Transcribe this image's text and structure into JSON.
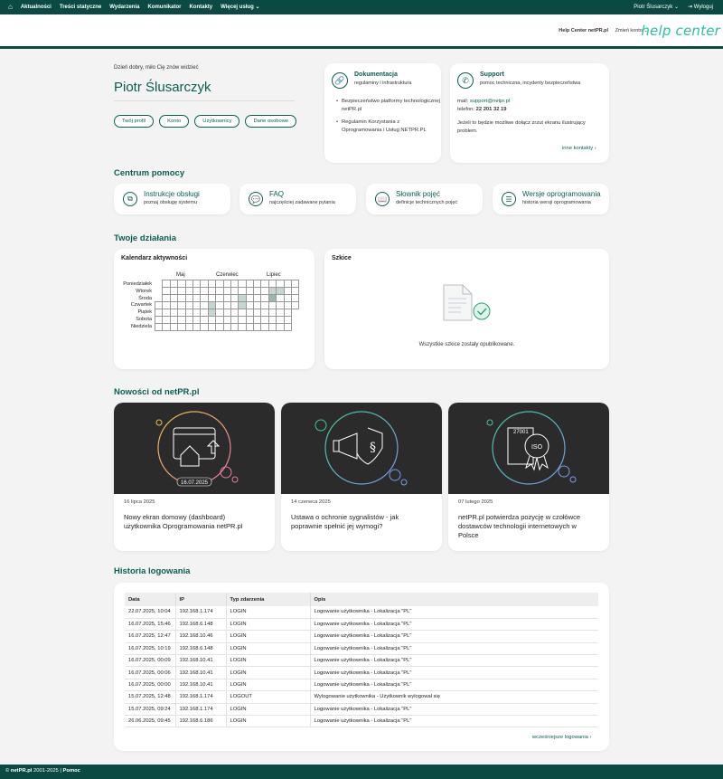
{
  "topnav": {
    "items": [
      "Aktualności",
      "Treści statyczne",
      "Wydarzenia",
      "Komunikator",
      "Kontakty",
      "Więcej usług"
    ],
    "user": "Piotr Ślusarczyk",
    "logout": "Wyloguj"
  },
  "header": {
    "help_center_link": "Help Center netPR.pl",
    "switch_account": "Zmień konto",
    "logo_text": "help center"
  },
  "profile": {
    "greeting": "Dzień dobry, miło Cię znów widzieć",
    "name": "Piotr Ślusarczyk",
    "buttons": [
      "Twój profil",
      "Konto",
      "Użytkownicy",
      "Dane osobowe"
    ]
  },
  "documentation": {
    "title": "Dokumentacja",
    "subtitle": "regulaminy i infrastruktura",
    "items": [
      "Bezpieczeństwo platformy technologicznej netPR.pl",
      "Regulamin Korzystania z Oprogramowania i Usług NETPR.PL"
    ]
  },
  "support": {
    "title": "Support",
    "subtitle": "pomoc techniczna, incydenty bezpieczeństwa",
    "mail_label": "mail:",
    "mail": "support@netpr.pl",
    "phone_label": "telefon:",
    "phone": "22 201 32 19",
    "note": "Jeżeli to będzie możliwe dołącz zrzut ekranu ilustrujący problem.",
    "more": "inne kontakty"
  },
  "help_center": {
    "title": "Centrum pomocy",
    "cards": [
      {
        "title": "Instrukcje obsługi",
        "subtitle": "poznaj obsługę systemu",
        "icon": "copy-icon"
      },
      {
        "title": "FAQ",
        "subtitle": "najczęściej zadawane pytania",
        "icon": "chat-icon"
      },
      {
        "title": "Słownik pojęć",
        "subtitle": "definicje technicznych pojęć",
        "icon": "book-icon"
      },
      {
        "title": "Wersje oprogramowania",
        "subtitle": "historia wersji oprogramowania",
        "icon": "layers-icon"
      }
    ]
  },
  "activity": {
    "title": "Twoje działania",
    "calendar_title": "Kalendarz aktywności",
    "months": [
      "Maj",
      "Czerwiec",
      "Lipiec"
    ],
    "days": [
      "Poniedziałek",
      "Wtorek",
      "Środa",
      "Czwartek",
      "Piątek",
      "Sobota",
      "Niedziela"
    ],
    "drafts_title": "Szkice",
    "drafts_empty": "Wszystkie szkice zostały opublikowane."
  },
  "news": {
    "title": "Nowości od netPR.pl",
    "items": [
      {
        "date": "16 lipca 2025",
        "title": "Nowy ekran domowy (dashboard) użytkownika Oprogramowania netPR.pl",
        "badge": "16.07.2025"
      },
      {
        "date": "14 czerwca 2025",
        "title": "Ustawa o ochronie sygnalistów - jak poprawnie spełnić jej wymogi?"
      },
      {
        "date": "07 lutego 2025",
        "title": "netPR.pl potwierdza pozycję w czołówce dostawców technologii internetowych w Polsce",
        "badge": "27001",
        "badge2": "ISO"
      }
    ]
  },
  "history": {
    "title": "Historia logowania",
    "columns": [
      "Data",
      "IP",
      "Typ zdarzenia",
      "Opis"
    ],
    "rows": [
      [
        "22.07.2025, 10:04",
        "192.168.1.174",
        "LOGIN",
        "Logowanie użytkownika - Lokalizacja \"PL\""
      ],
      [
        "16.07.2025, 15:46",
        "192.168.6.148",
        "LOGIN",
        "Logowanie użytkownika - Lokalizacja \"PL\""
      ],
      [
        "16.07.2025, 12:47",
        "192.168.10.46",
        "LOGIN",
        "Logowanie użytkownika - Lokalizacja \"PL\""
      ],
      [
        "16.07.2025, 10:19",
        "192.168.6.148",
        "LOGIN",
        "Logowanie użytkownika - Lokalizacja \"PL\""
      ],
      [
        "16.07.2025, 00:09",
        "192.168.10.41",
        "LOGIN",
        "Logowanie użytkownika - Lokalizacja \"PL\""
      ],
      [
        "16.07.2025, 00:06",
        "192.168.10.41",
        "LOGIN",
        "Logowanie użytkownika - Lokalizacja \"PL\""
      ],
      [
        "16.07.2025, 00:00",
        "192.168.10.41",
        "LOGIN",
        "Logowanie użytkownika - Lokalizacja \"PL\""
      ],
      [
        "15.07.2025, 12:48",
        "192.168.1.174",
        "LOGOUT",
        "Wylogowanie użytkownika - Użytkownik wylogował się"
      ],
      [
        "15.07.2025, 09:24",
        "192.168.1.174",
        "LOGIN",
        "Logowanie użytkownika - Lokalizacja \"PL\""
      ],
      [
        "26.06.2025, 09:45",
        "192.168.6.186",
        "LOGIN",
        "Logowanie użytkownika - Lokalizacja \"PL\""
      ]
    ],
    "more": "wcześniejsze logowania"
  },
  "footer": {
    "brand": "netPR.pl",
    "years": "2001-2025",
    "separator": "|",
    "help": "Pomoc"
  },
  "colors": {
    "primary": "#0b4a42",
    "accent": "#2bbfa4"
  }
}
